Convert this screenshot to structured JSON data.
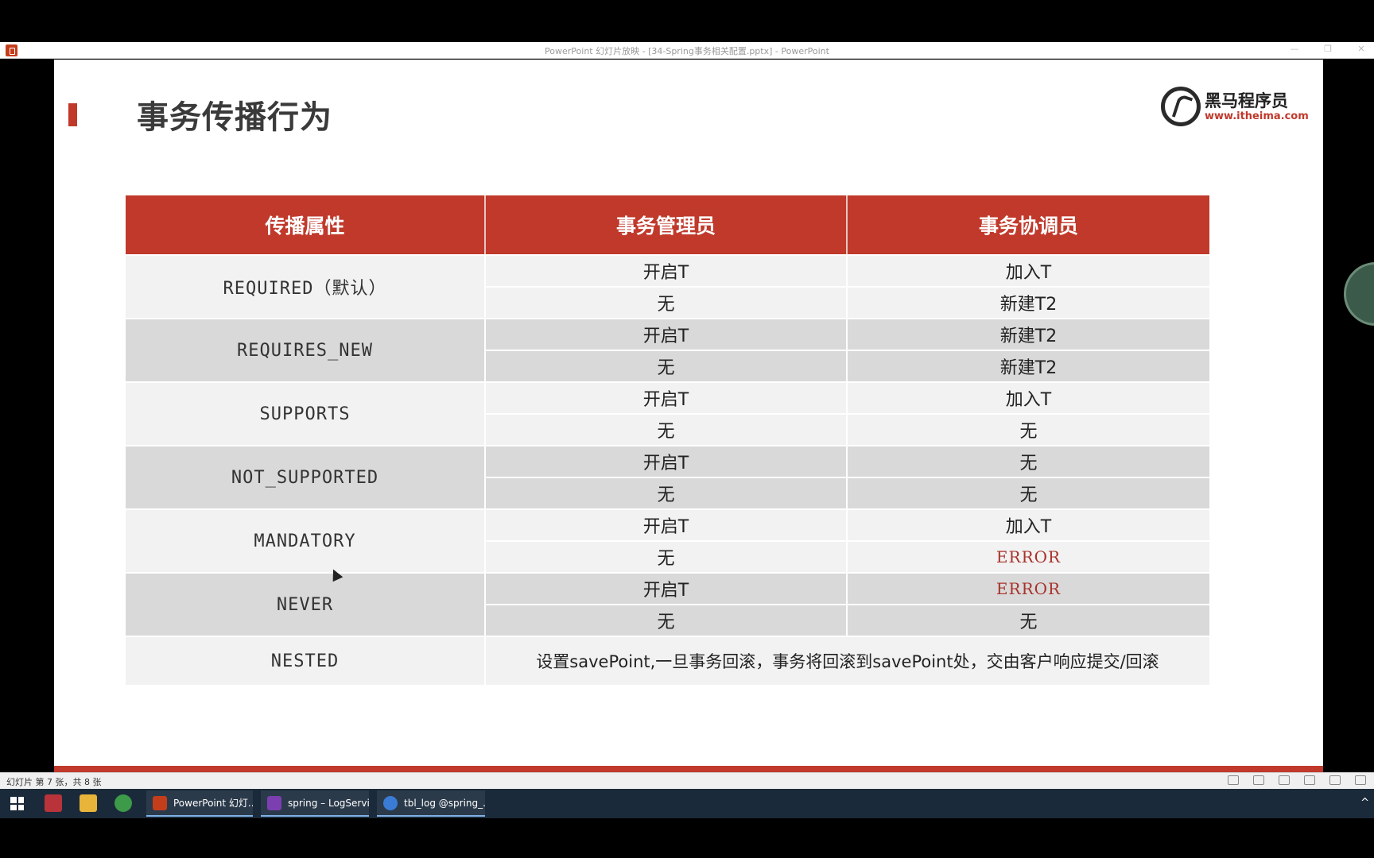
{
  "window": {
    "title": "PowerPoint 幻灯片放映 - [34-Spring事务相关配置.pptx] - PowerPoint",
    "controls": [
      "—",
      "❐",
      "✕"
    ]
  },
  "slide": {
    "title": "事务传播行为",
    "logo": {
      "name": "黑马程序员",
      "url": "www.itheima.com"
    },
    "table": {
      "headers": [
        "传播属性",
        "事务管理员",
        "事务协调员"
      ],
      "groups": [
        {
          "name": "REQUIRED（默认）",
          "rows": [
            {
              "mgr": "开启T",
              "crd": "加入T"
            },
            {
              "mgr": "无",
              "crd": "新建T2"
            }
          ]
        },
        {
          "name": "REQUIRES_NEW",
          "rows": [
            {
              "mgr": "开启T",
              "crd": "新建T2"
            },
            {
              "mgr": "无",
              "crd": "新建T2"
            }
          ]
        },
        {
          "name": "SUPPORTS",
          "rows": [
            {
              "mgr": "开启T",
              "crd": "加入T"
            },
            {
              "mgr": "无",
              "crd": "无"
            }
          ]
        },
        {
          "name": "NOT_SUPPORTED",
          "rows": [
            {
              "mgr": "开启T",
              "crd": "无"
            },
            {
              "mgr": "无",
              "crd": "无"
            }
          ]
        },
        {
          "name": "MANDATORY",
          "rows": [
            {
              "mgr": "开启T",
              "crd": "加入T"
            },
            {
              "mgr": "无",
              "crd": "ERROR"
            }
          ]
        },
        {
          "name": "NEVER",
          "rows": [
            {
              "mgr": "开启T",
              "crd": "ERROR"
            },
            {
              "mgr": "无",
              "crd": "无"
            }
          ]
        }
      ],
      "nested": {
        "name": "NESTED",
        "description": "设置savePoint,一旦事务回滚，事务将回滚到savePoint处，交由客户响应提交/回滚"
      }
    }
  },
  "statusbar": {
    "text": "幻灯片 第 7 张，共 8 张"
  },
  "taskbar": {
    "apps": [
      {
        "label": "PowerPoint 幻灯...",
        "color": "#c43e1c"
      },
      {
        "label": "spring – LogServi...",
        "color": "#7b3fb0"
      },
      {
        "label": "tbl_log @spring_...",
        "color": "#3a7bd5"
      }
    ]
  },
  "colors": {
    "accent": "#c0392b",
    "error": "#a8322a",
    "header_text": "#ffffff"
  }
}
